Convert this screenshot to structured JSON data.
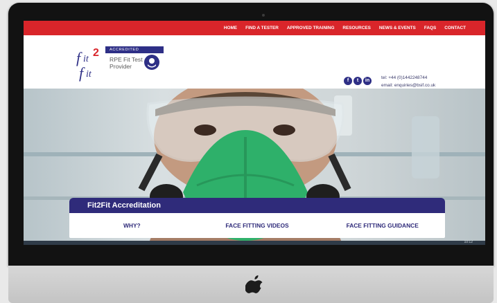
{
  "nav": {
    "items": [
      "HOME",
      "FIND A TESTER",
      "APPROVED TRAINING",
      "RESOURCES",
      "NEWS & EVENTS",
      "FAQS",
      "CONTACT"
    ]
  },
  "logo": {
    "banner": "ACCREDITED",
    "text": "RPE Fit Test\nProvider",
    "brand_color": "#2e2f86"
  },
  "contact": {
    "tel": "tel: +44 (0)1442248744",
    "email": "email: enquiries@bsif.co.uk"
  },
  "social": {
    "facebook": "f",
    "twitter": "t",
    "linkedin": "in"
  },
  "panel": {
    "title": "Fit2Fit Accreditation",
    "tabs": [
      "WHY?",
      "FACE FITTING VIDEOS",
      "FACE FITTING GUIDANCE"
    ]
  },
  "taskbar": {
    "clock": "10:12"
  },
  "colors": {
    "nav_red": "#d9252a",
    "panel_purple": "#2f2b7a",
    "mask_green": "#2eb06a"
  }
}
